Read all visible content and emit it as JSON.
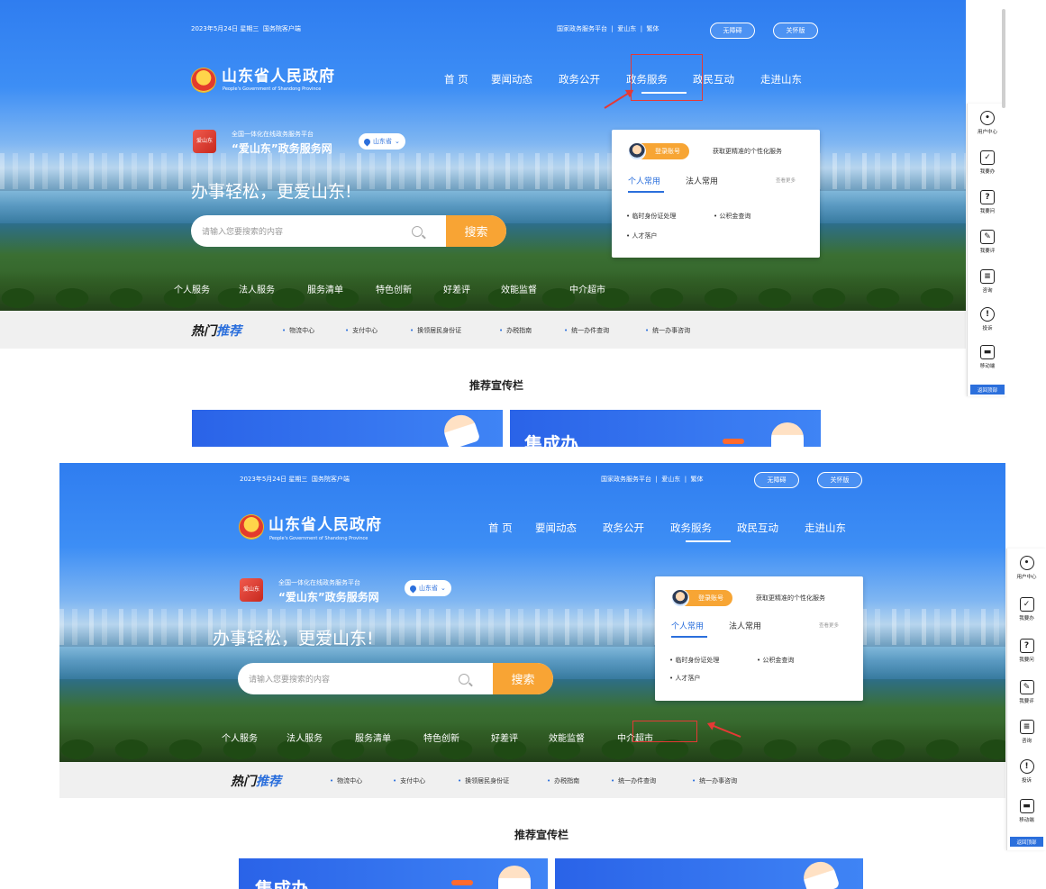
{
  "header": {
    "date": "2023年5月24日 星期三",
    "client": "国务院客户端",
    "links": [
      "国家政务服务平台",
      "爱山东",
      "繁体"
    ],
    "pill_accessible": "无障碍",
    "pill_care": "关怀版"
  },
  "brand": {
    "name": "山东省人民政府",
    "english": "People's Government of Shandong Province"
  },
  "nav": [
    "首 页",
    "要闻动态",
    "政务公开",
    "政务服务",
    "政民互动",
    "走进山东"
  ],
  "platform": {
    "subtitle": "全国一体化在线政务服务平台",
    "name": "“爱山东”政务服务网",
    "app_icon_text": "爱山东",
    "region": "山东省"
  },
  "slogan": "办事轻松，更爱山东!",
  "search": {
    "placeholder": "请输入您要搜索的内容",
    "button": "搜索"
  },
  "services": [
    "个人服务",
    "法人服务",
    "服务清单",
    "特色创新",
    "好差评",
    "效能监督",
    "中介超市"
  ],
  "card": {
    "login": "登录账号",
    "perk": "获取更精准的个性化服务",
    "tabs": [
      "个人常用",
      "法人常用"
    ],
    "more": "查看更多",
    "items": [
      "临时身份证处理",
      "公积金查询",
      "人才落户"
    ]
  },
  "hot": {
    "label_a": "热门",
    "label_b": "推荐",
    "items": [
      "物流中心",
      "支付中心",
      "换领居民身份证",
      "办税指南",
      "统一办件查询",
      "统一办事咨询"
    ]
  },
  "recommend_title": "推荐宣传栏",
  "banners": [
    "集成办"
  ],
  "sidebar": {
    "items": [
      "用户中心",
      "我要办",
      "我要问",
      "我要评",
      "咨询",
      "投诉",
      "移动端"
    ],
    "back": "返回顶部"
  },
  "colors": {
    "primary": "#2b6fdc",
    "accent": "#f8a434",
    "annotation": "#e53935"
  }
}
